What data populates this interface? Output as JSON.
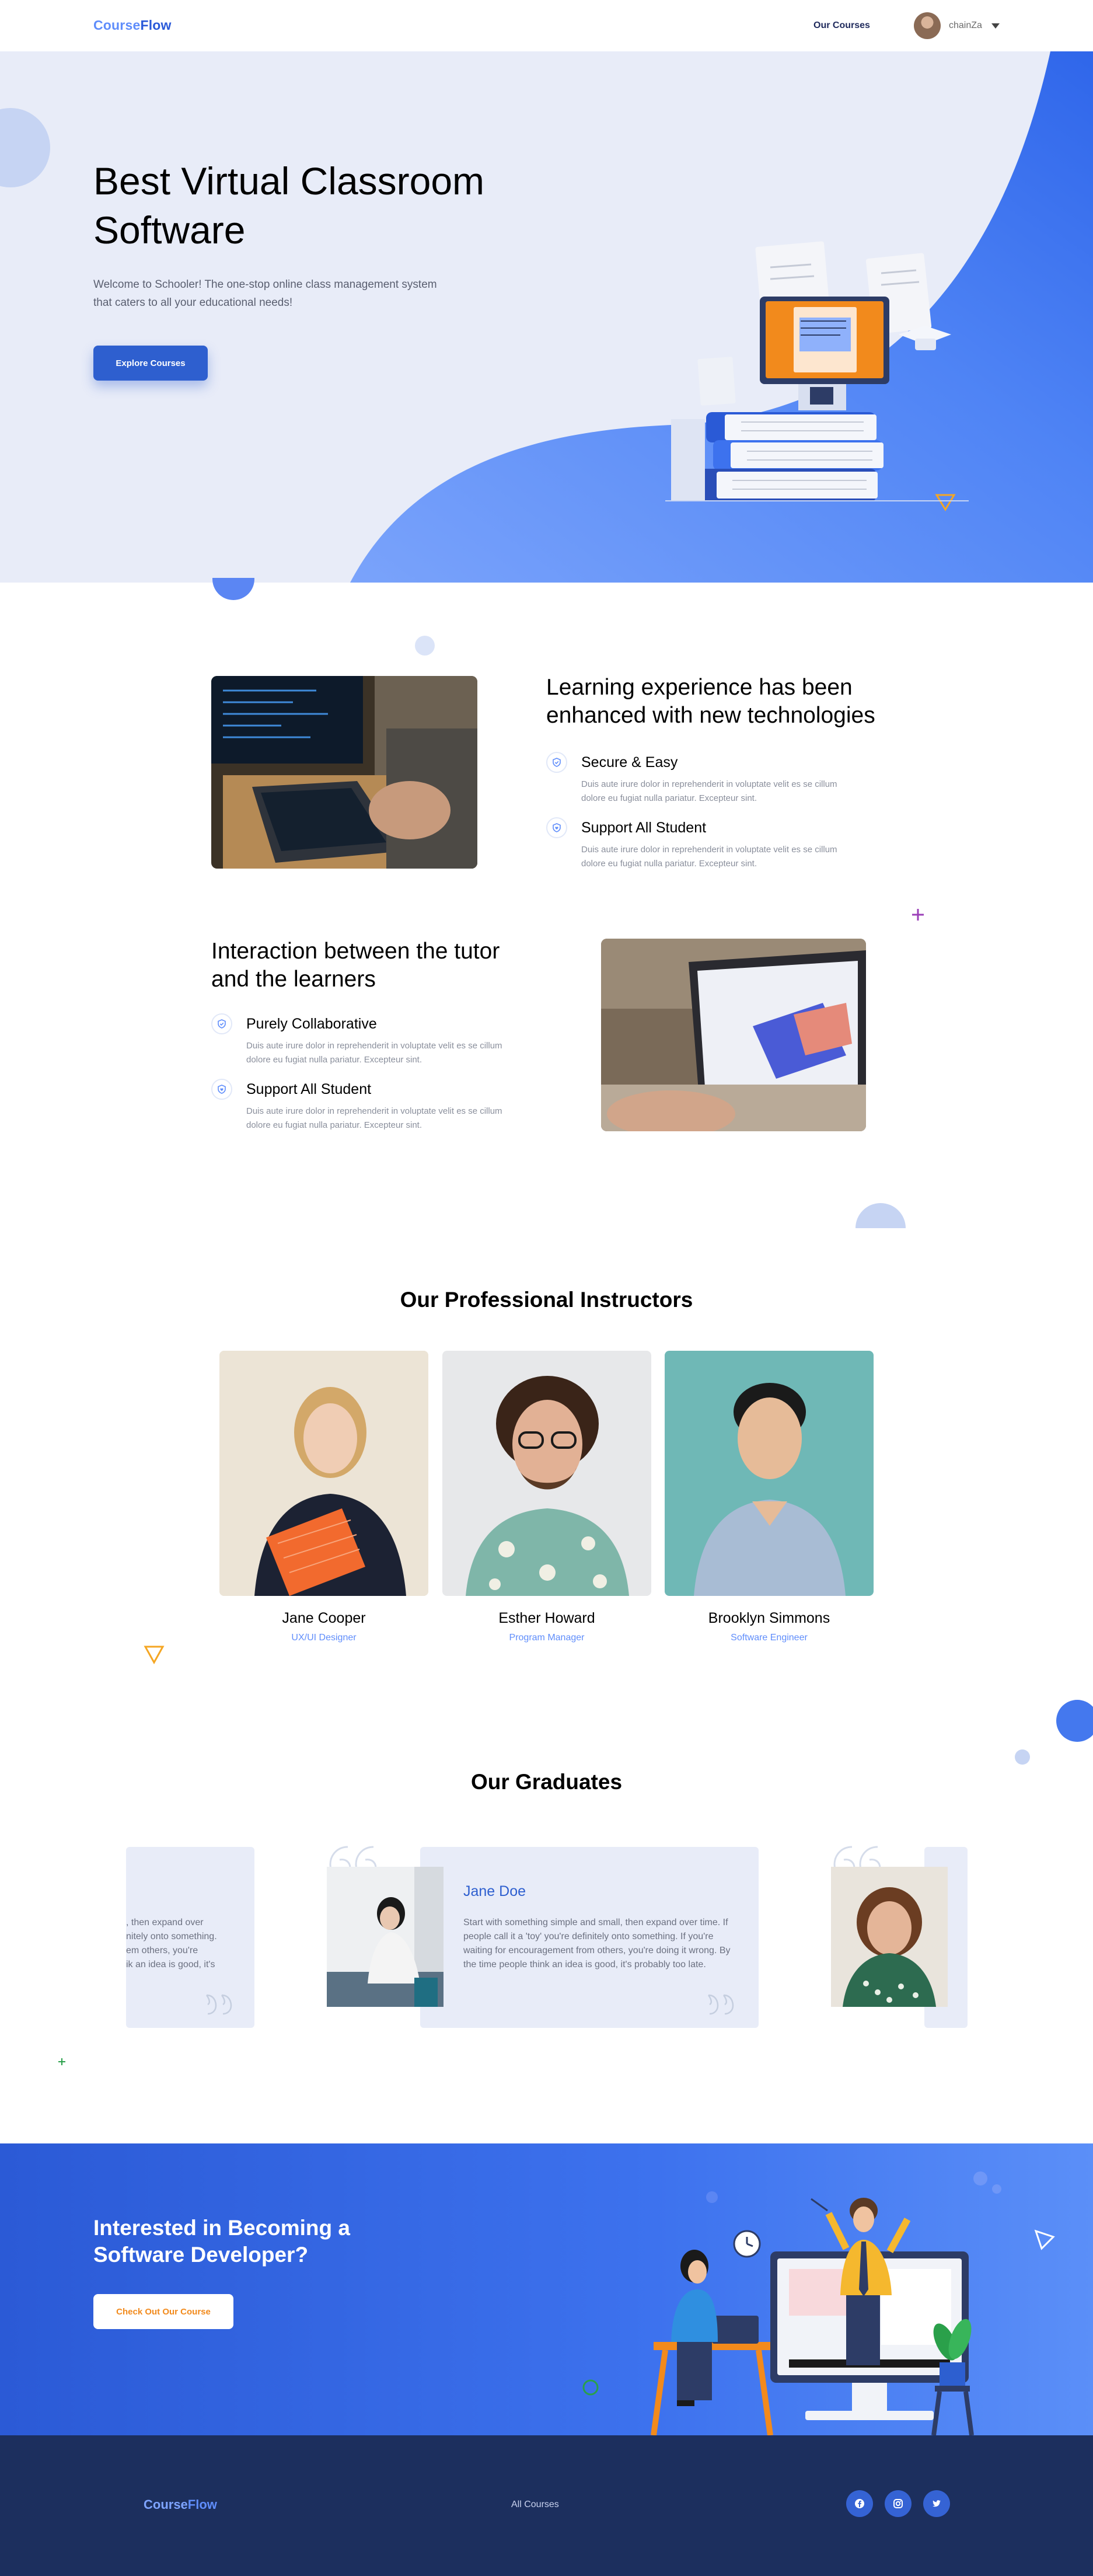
{
  "nav": {
    "logo_part1": "Course",
    "logo_part2": "Flow",
    "link_courses": "Our Courses",
    "user_name": "chainZa"
  },
  "hero": {
    "title": "Best Virtual Classroom Software",
    "subtitle": "Welcome to Schooler! The one-stop online class management system that caters to all your educational needs!",
    "button": "Explore Courses"
  },
  "feature1": {
    "heading": "Learning experience has been enhanced with new technologies",
    "items": [
      {
        "title": "Secure & Easy",
        "text": "Duis aute irure dolor in reprehenderit in voluptate velit es se cillum dolore eu fugiat nulla pariatur. Excepteur sint."
      },
      {
        "title": "Support All Student",
        "text": "Duis aute irure dolor in reprehenderit in voluptate velit es se cillum dolore eu fugiat nulla pariatur. Excepteur sint."
      }
    ]
  },
  "feature2": {
    "heading": "Interaction between the tutor and the learners",
    "items": [
      {
        "title": "Purely Collaborative",
        "text": "Duis aute irure dolor in reprehenderit in voluptate velit es se cillum dolore eu fugiat nulla pariatur. Excepteur sint."
      },
      {
        "title": "Support All Student",
        "text": "Duis aute irure dolor in reprehenderit in voluptate velit es se cillum dolore eu fugiat nulla pariatur. Excepteur sint."
      }
    ]
  },
  "instructors": {
    "heading": "Our Professional Instructors",
    "list": [
      {
        "name": "Jane Cooper",
        "role": "UX/UI Designer"
      },
      {
        "name": "Esther Howard",
        "role": "Program Manager"
      },
      {
        "name": "Brooklyn Simmons",
        "role": "Software Engineer"
      }
    ]
  },
  "graduates": {
    "heading": "Our Graduates",
    "left_partial": [
      ", then expand over",
      "nitely onto something.",
      "em others, you're",
      "ik an idea is good, it's"
    ],
    "featured": {
      "name": "Jane Doe",
      "text": "Start with something simple and small, then expand over time. If people call it a 'toy' you're definitely onto something. If you're waiting for encouragement from others, you're doing it wrong. By the time people think an idea is good, it's probably too late."
    }
  },
  "cta": {
    "title": "Interested in Becoming a Software Developer?",
    "button": "Check Out Our Course"
  },
  "footer": {
    "logo_part1": "Course",
    "logo_part2": "Flow",
    "link": "All Courses",
    "social": [
      "facebook-icon",
      "instagram-icon",
      "twitter-icon"
    ]
  },
  "colors": {
    "primary": "#2e5fcf",
    "accent_light": "#5f8dfb",
    "hero_bg": "#e8ecf8",
    "footer_bg": "#1c2f5e",
    "cta_button_text": "#f28a1c"
  }
}
